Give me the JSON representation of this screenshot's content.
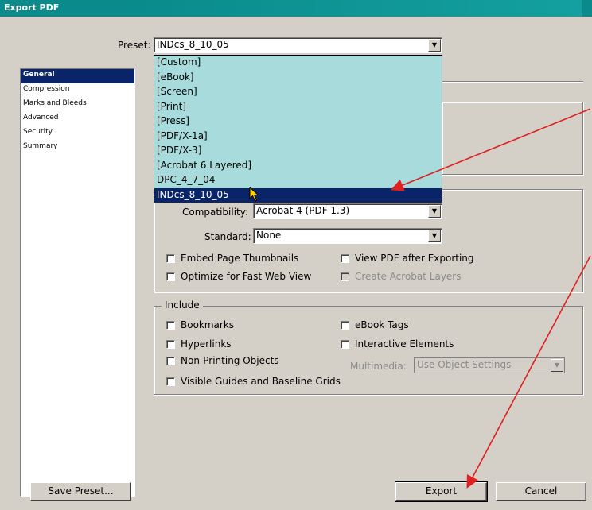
{
  "window": {
    "title": "Export PDF"
  },
  "preset": {
    "label": "Preset:",
    "value": "INDcs_8_10_05",
    "options": [
      "[Custom]",
      "[eBook]",
      "[Screen]",
      "[Print]",
      "[Press]",
      "[PDF/X-1a]",
      "[PDF/X-3]",
      "[Acrobat 6 Layered]",
      "DPC_4_7_04",
      "INDcs_8_10_05"
    ],
    "selected_index": 9
  },
  "sidebar": {
    "items": [
      {
        "label": "General",
        "active": true
      },
      {
        "label": "Compression",
        "active": false
      },
      {
        "label": "Marks and Bleeds",
        "active": false
      },
      {
        "label": "Advanced",
        "active": false
      },
      {
        "label": "Security",
        "active": false
      },
      {
        "label": "Summary",
        "active": false
      }
    ]
  },
  "compatibility": {
    "label": "Compatibility:",
    "value": "Acrobat 4 (PDF 1.3)"
  },
  "standard": {
    "label": "Standard:",
    "value": "None"
  },
  "options": {
    "embed_thumbnails": "Embed Page Thumbnails",
    "view_after_export": "View PDF after Exporting",
    "optimize_web": "Optimize for Fast Web View",
    "create_layers": "Create Acrobat Layers"
  },
  "include": {
    "title": "Include",
    "bookmarks": "Bookmarks",
    "ebook_tags": "eBook Tags",
    "hyperlinks": "Hyperlinks",
    "interactive": "Interactive Elements",
    "non_printing": "Non-Printing Objects",
    "multimedia_label": "Multimedia:",
    "multimedia_value": "Use Object Settings",
    "guides": "Visible Guides and Baseline Grids"
  },
  "buttons": {
    "save_preset": "Save Preset...",
    "export": "Export",
    "cancel": "Cancel"
  },
  "colors": {
    "titlebar": "#0a8a8a",
    "selection": "#0a246a",
    "dropdown_bg": "#a8dcdc",
    "annotation_arrow": "#e02020"
  }
}
